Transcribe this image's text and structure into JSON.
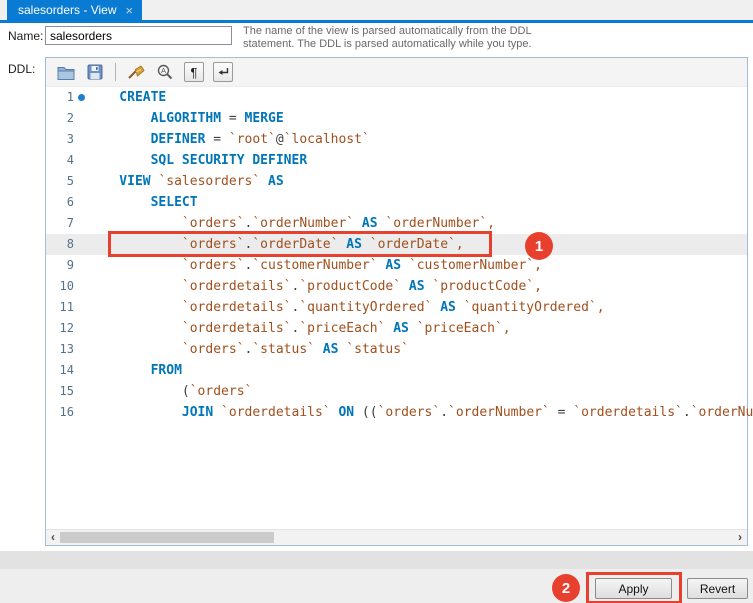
{
  "tab": {
    "title": "salesorders - View",
    "close_glyph": "×"
  },
  "form": {
    "name_label": "Name:",
    "name_value": "salesorders",
    "help_line1": "The name of the view is parsed automatically from the DDL",
    "help_line2": "statement. The DDL is parsed automatically while you type.",
    "ddl_label": "DDL:"
  },
  "toolbar": {
    "icons": [
      "open-file-icon",
      "save-icon",
      "beautify-icon",
      "find-icon",
      "show-invisibles-icon",
      "word-wrap-icon"
    ],
    "pilcrow_glyph": "¶"
  },
  "editor": {
    "current_line": 8,
    "scrollbar": {
      "left_glyph": "‹",
      "right_glyph": "›"
    },
    "lines": [
      {
        "n": 1,
        "marker": true,
        "indent": 1,
        "tokens": [
          {
            "t": "CREATE",
            "c": "kw"
          }
        ]
      },
      {
        "n": 2,
        "indent": 2,
        "tokens": [
          {
            "t": "ALGORITHM",
            "c": "kw"
          },
          {
            "t": " = ",
            "c": "op"
          },
          {
            "t": "MERGE",
            "c": "kw"
          }
        ]
      },
      {
        "n": 3,
        "indent": 2,
        "tokens": [
          {
            "t": "DEFINER",
            "c": "kw"
          },
          {
            "t": " = ",
            "c": "op"
          },
          {
            "t": "`root`",
            "c": "id"
          },
          {
            "t": "@",
            "c": "op"
          },
          {
            "t": "`localhost`",
            "c": "id"
          }
        ]
      },
      {
        "n": 4,
        "indent": 2,
        "tokens": [
          {
            "t": "SQL SECURITY DEFINER",
            "c": "kw"
          }
        ]
      },
      {
        "n": 5,
        "indent": 1,
        "tokens": [
          {
            "t": "VIEW",
            "c": "kw"
          },
          {
            "t": " ",
            "c": "op"
          },
          {
            "t": "`salesorders`",
            "c": "id"
          },
          {
            "t": " ",
            "c": "op"
          },
          {
            "t": "AS",
            "c": "kw"
          }
        ]
      },
      {
        "n": 6,
        "indent": 2,
        "tokens": [
          {
            "t": "SELECT",
            "c": "kw"
          }
        ]
      },
      {
        "n": 7,
        "indent": 3,
        "tokens": [
          {
            "t": "`orders`",
            "c": "id"
          },
          {
            "t": ".",
            "c": "op"
          },
          {
            "t": "`orderNumber`",
            "c": "id"
          },
          {
            "t": " AS ",
            "c": "kw"
          },
          {
            "t": "`orderNumber`,",
            "c": "id"
          }
        ]
      },
      {
        "n": 8,
        "indent": 3,
        "tokens": [
          {
            "t": "`orders`",
            "c": "id"
          },
          {
            "t": ".",
            "c": "op"
          },
          {
            "t": "`orderDate`",
            "c": "id"
          },
          {
            "t": " AS ",
            "c": "kw"
          },
          {
            "t": "`orderDate`,",
            "c": "id"
          }
        ]
      },
      {
        "n": 9,
        "indent": 3,
        "tokens": [
          {
            "t": "`orders`",
            "c": "id"
          },
          {
            "t": ".",
            "c": "op"
          },
          {
            "t": "`customerNumber`",
            "c": "id"
          },
          {
            "t": " AS ",
            "c": "kw"
          },
          {
            "t": "`customerNumber`,",
            "c": "id"
          }
        ]
      },
      {
        "n": 10,
        "indent": 3,
        "tokens": [
          {
            "t": "`orderdetails`",
            "c": "id"
          },
          {
            "t": ".",
            "c": "op"
          },
          {
            "t": "`productCode`",
            "c": "id"
          },
          {
            "t": " AS ",
            "c": "kw"
          },
          {
            "t": "`productCode`,",
            "c": "id"
          }
        ]
      },
      {
        "n": 11,
        "indent": 3,
        "tokens": [
          {
            "t": "`orderdetails`",
            "c": "id"
          },
          {
            "t": ".",
            "c": "op"
          },
          {
            "t": "`quantityOrdered`",
            "c": "id"
          },
          {
            "t": " AS ",
            "c": "kw"
          },
          {
            "t": "`quantityOrdered`,",
            "c": "id"
          }
        ]
      },
      {
        "n": 12,
        "indent": 3,
        "tokens": [
          {
            "t": "`orderdetails`",
            "c": "id"
          },
          {
            "t": ".",
            "c": "op"
          },
          {
            "t": "`priceEach`",
            "c": "id"
          },
          {
            "t": " AS ",
            "c": "kw"
          },
          {
            "t": "`priceEach`,",
            "c": "id"
          }
        ]
      },
      {
        "n": 13,
        "indent": 3,
        "tokens": [
          {
            "t": "`orders`",
            "c": "id"
          },
          {
            "t": ".",
            "c": "op"
          },
          {
            "t": "`status`",
            "c": "id"
          },
          {
            "t": " AS ",
            "c": "kw"
          },
          {
            "t": "`status`",
            "c": "id"
          }
        ]
      },
      {
        "n": 14,
        "indent": 2,
        "tokens": [
          {
            "t": "FROM",
            "c": "kw"
          }
        ]
      },
      {
        "n": 15,
        "indent": 3,
        "tokens": [
          {
            "t": "(",
            "c": "op"
          },
          {
            "t": "`orders`",
            "c": "id"
          }
        ]
      },
      {
        "n": 16,
        "indent": 3,
        "tokens": [
          {
            "t": "JOIN",
            "c": "kw"
          },
          {
            "t": " ",
            "c": "op"
          },
          {
            "t": "`orderdetails`",
            "c": "id"
          },
          {
            "t": " ",
            "c": "op"
          },
          {
            "t": "ON",
            "c": "kw"
          },
          {
            "t": " ((",
            "c": "op"
          },
          {
            "t": "`orders`",
            "c": "id"
          },
          {
            "t": ".",
            "c": "op"
          },
          {
            "t": "`orderNumber`",
            "c": "id"
          },
          {
            "t": " = ",
            "c": "op"
          },
          {
            "t": "`orderdetails`",
            "c": "id"
          },
          {
            "t": ".",
            "c": "op"
          },
          {
            "t": "`orderNumber`",
            "c": "id"
          },
          {
            "t": ")))",
            "c": "op"
          }
        ]
      }
    ]
  },
  "annotations": {
    "step1_label": "1",
    "step2_label": "2"
  },
  "buttons": {
    "apply": "Apply",
    "revert": "Revert"
  },
  "colors": {
    "tab_blue": "#0a7bd2",
    "keyword_blue": "#0076b8",
    "identifier_rust": "#a0501e",
    "annotation_red": "#e8402e",
    "current_line_bg": "#ececec",
    "line_number": "#56718a"
  }
}
